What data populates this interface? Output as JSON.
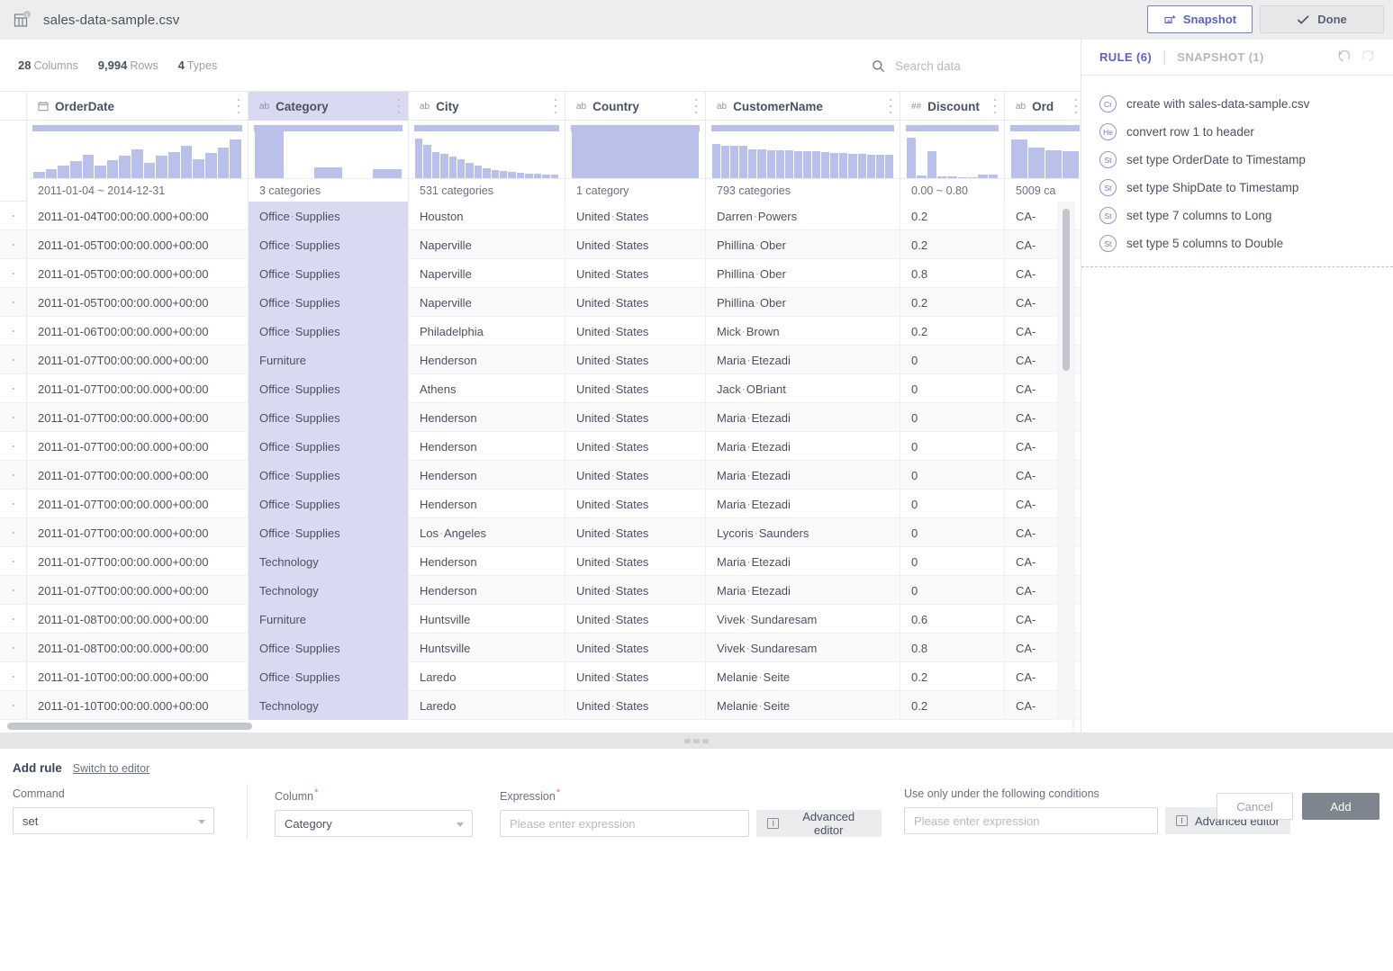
{
  "titlebar": {
    "file_icon": "csv-table-icon",
    "filename": "sales-data-sample.csv",
    "snapshot_label": "Snapshot",
    "snapshot_icon": "snapshot-camera-icon",
    "done_label": "Done",
    "done_icon": "check-icon"
  },
  "meta": {
    "columns_count": "28",
    "columns_label": "Columns",
    "rows_count": "9,994",
    "rows_label": "Rows",
    "types_count": "4",
    "types_label": "Types"
  },
  "search": {
    "icon": "search-icon",
    "placeholder": "Search data",
    "value": ""
  },
  "grid": {
    "columns": [
      {
        "name": "OrderDate",
        "type_tag": "",
        "type_icon": "calendar-icon",
        "selected": false,
        "summary": "2011-01-04 ~ 2014-12-31",
        "hist": [
          14,
          20,
          26,
          36,
          50,
          26,
          38,
          48,
          62,
          32,
          48,
          56,
          70,
          40,
          54,
          66,
          82
        ]
      },
      {
        "name": "Category",
        "type_tag": "ab",
        "type_icon": "",
        "selected": true,
        "summary": "3 categories",
        "hist": [
          100,
          0,
          24,
          0,
          20
        ]
      },
      {
        "name": "City",
        "type_tag": "ab",
        "type_icon": "",
        "selected": false,
        "summary": "531 categories",
        "hist": [
          84,
          72,
          56,
          52,
          46,
          40,
          32,
          26,
          22,
          18,
          15,
          13,
          11,
          10,
          9,
          8,
          7
        ]
      },
      {
        "name": "Country",
        "type_tag": "ab",
        "type_icon": "",
        "selected": false,
        "summary": "1 category",
        "hist": [
          100
        ]
      },
      {
        "name": "CustomerName",
        "type_tag": "ab",
        "type_icon": "",
        "selected": false,
        "summary": "793 categories",
        "hist": [
          74,
          70,
          70,
          70,
          62,
          62,
          60,
          60,
          60,
          58,
          58,
          58,
          56,
          54,
          54,
          52,
          52,
          50,
          50,
          50
        ]
      },
      {
        "name": "Discount",
        "type_tag": "##",
        "type_icon": "",
        "selected": false,
        "summary": "0.00 ~ 0.80",
        "hist": [
          86,
          5,
          58,
          4,
          3,
          2,
          2,
          8,
          7
        ]
      },
      {
        "name": "Ord",
        "type_tag": "ab",
        "type_icon": "",
        "selected": false,
        "summary": "5009 ca",
        "hist": [
          82,
          66,
          60,
          58
        ]
      }
    ],
    "rows": [
      {
        "OrderDate": "2011-01-04T00:00:00.000+00:00",
        "Category": "Office Supplies",
        "City": "Houston",
        "Country": "United States",
        "CustomerName": "Darren Powers",
        "Discount": "0.2",
        "Ord": "CA-"
      },
      {
        "OrderDate": "2011-01-05T00:00:00.000+00:00",
        "Category": "Office Supplies",
        "City": "Naperville",
        "Country": "United States",
        "CustomerName": "Phillina Ober",
        "Discount": "0.2",
        "Ord": "CA-"
      },
      {
        "OrderDate": "2011-01-05T00:00:00.000+00:00",
        "Category": "Office Supplies",
        "City": "Naperville",
        "Country": "United States",
        "CustomerName": "Phillina Ober",
        "Discount": "0.8",
        "Ord": "CA-"
      },
      {
        "OrderDate": "2011-01-05T00:00:00.000+00:00",
        "Category": "Office Supplies",
        "City": "Naperville",
        "Country": "United States",
        "CustomerName": "Phillina Ober",
        "Discount": "0.2",
        "Ord": "CA-"
      },
      {
        "OrderDate": "2011-01-06T00:00:00.000+00:00",
        "Category": "Office Supplies",
        "City": "Philadelphia",
        "Country": "United States",
        "CustomerName": "Mick Brown",
        "Discount": "0.2",
        "Ord": "CA-"
      },
      {
        "OrderDate": "2011-01-07T00:00:00.000+00:00",
        "Category": "Furniture",
        "City": "Henderson",
        "Country": "United States",
        "CustomerName": "Maria Etezadi",
        "Discount": "0",
        "Ord": "CA-"
      },
      {
        "OrderDate": "2011-01-07T00:00:00.000+00:00",
        "Category": "Office Supplies",
        "City": "Athens",
        "Country": "United States",
        "CustomerName": "Jack OBriant",
        "Discount": "0",
        "Ord": "CA-"
      },
      {
        "OrderDate": "2011-01-07T00:00:00.000+00:00",
        "Category": "Office Supplies",
        "City": "Henderson",
        "Country": "United States",
        "CustomerName": "Maria Etezadi",
        "Discount": "0",
        "Ord": "CA-"
      },
      {
        "OrderDate": "2011-01-07T00:00:00.000+00:00",
        "Category": "Office Supplies",
        "City": "Henderson",
        "Country": "United States",
        "CustomerName": "Maria Etezadi",
        "Discount": "0",
        "Ord": "CA-"
      },
      {
        "OrderDate": "2011-01-07T00:00:00.000+00:00",
        "Category": "Office Supplies",
        "City": "Henderson",
        "Country": "United States",
        "CustomerName": "Maria Etezadi",
        "Discount": "0",
        "Ord": "CA-"
      },
      {
        "OrderDate": "2011-01-07T00:00:00.000+00:00",
        "Category": "Office Supplies",
        "City": "Henderson",
        "Country": "United States",
        "CustomerName": "Maria Etezadi",
        "Discount": "0",
        "Ord": "CA-"
      },
      {
        "OrderDate": "2011-01-07T00:00:00.000+00:00",
        "Category": "Office Supplies",
        "City": "Los Angeles",
        "Country": "United States",
        "CustomerName": "Lycoris Saunders",
        "Discount": "0",
        "Ord": "CA-"
      },
      {
        "OrderDate": "2011-01-07T00:00:00.000+00:00",
        "Category": "Technology",
        "City": "Henderson",
        "Country": "United States",
        "CustomerName": "Maria Etezadi",
        "Discount": "0",
        "Ord": "CA-"
      },
      {
        "OrderDate": "2011-01-07T00:00:00.000+00:00",
        "Category": "Technology",
        "City": "Henderson",
        "Country": "United States",
        "CustomerName": "Maria Etezadi",
        "Discount": "0",
        "Ord": "CA-"
      },
      {
        "OrderDate": "2011-01-08T00:00:00.000+00:00",
        "Category": "Furniture",
        "City": "Huntsville",
        "Country": "United States",
        "CustomerName": "Vivek Sundaresam",
        "Discount": "0.6",
        "Ord": "CA-"
      },
      {
        "OrderDate": "2011-01-08T00:00:00.000+00:00",
        "Category": "Office Supplies",
        "City": "Huntsville",
        "Country": "United States",
        "CustomerName": "Vivek Sundaresam",
        "Discount": "0.8",
        "Ord": "CA-"
      },
      {
        "OrderDate": "2011-01-10T00:00:00.000+00:00",
        "Category": "Office Supplies",
        "City": "Laredo",
        "Country": "United States",
        "CustomerName": "Melanie Seite",
        "Discount": "0.2",
        "Ord": "CA-"
      },
      {
        "OrderDate": "2011-01-10T00:00:00.000+00:00",
        "Category": "Technology",
        "City": "Laredo",
        "Country": "United States",
        "CustomerName": "Melanie Seite",
        "Discount": "0.2",
        "Ord": "CA-"
      }
    ]
  },
  "rule_panel": {
    "tab_rule": "RULE (6)",
    "tab_snapshot": "SNAPSHOT (1)",
    "undo_icon": "undo-icon",
    "redo_icon": "redo-icon",
    "rules": [
      {
        "badge": "Cr",
        "text": "create with sales-data-sample.csv"
      },
      {
        "badge": "He",
        "text": "convert row 1 to header"
      },
      {
        "badge": "St",
        "text": "set type OrderDate to Timestamp"
      },
      {
        "badge": "St",
        "text": "set type ShipDate to Timestamp"
      },
      {
        "badge": "St",
        "text": "set type 7 columns to Long"
      },
      {
        "badge": "St",
        "text": "set type 5 columns to Double"
      }
    ]
  },
  "add_rule": {
    "title": "Add rule",
    "switch_link": "Switch to editor",
    "command_label": "Command",
    "command_value": "set",
    "column_label": "Column",
    "column_value": "Category",
    "expression_label": "Expression",
    "expression_placeholder": "Please enter expression",
    "expression_value": "",
    "advanced_editor_label": "Advanced editor",
    "advanced_editor_icon": "text-cursor-icon",
    "conditions_label": "Use only under the following conditions",
    "conditions_placeholder": "Please enter expression",
    "conditions_value": "",
    "advanced_editor2_label": "Advanced editor",
    "cancel_label": "Cancel",
    "add_label": "Add"
  },
  "colors": {
    "accent": "#5b5fc7",
    "selection": "#d9daf2",
    "histogram": "#b9c0ea",
    "space_marker": "#e0609a",
    "titlebar_bg": "#eceded"
  }
}
